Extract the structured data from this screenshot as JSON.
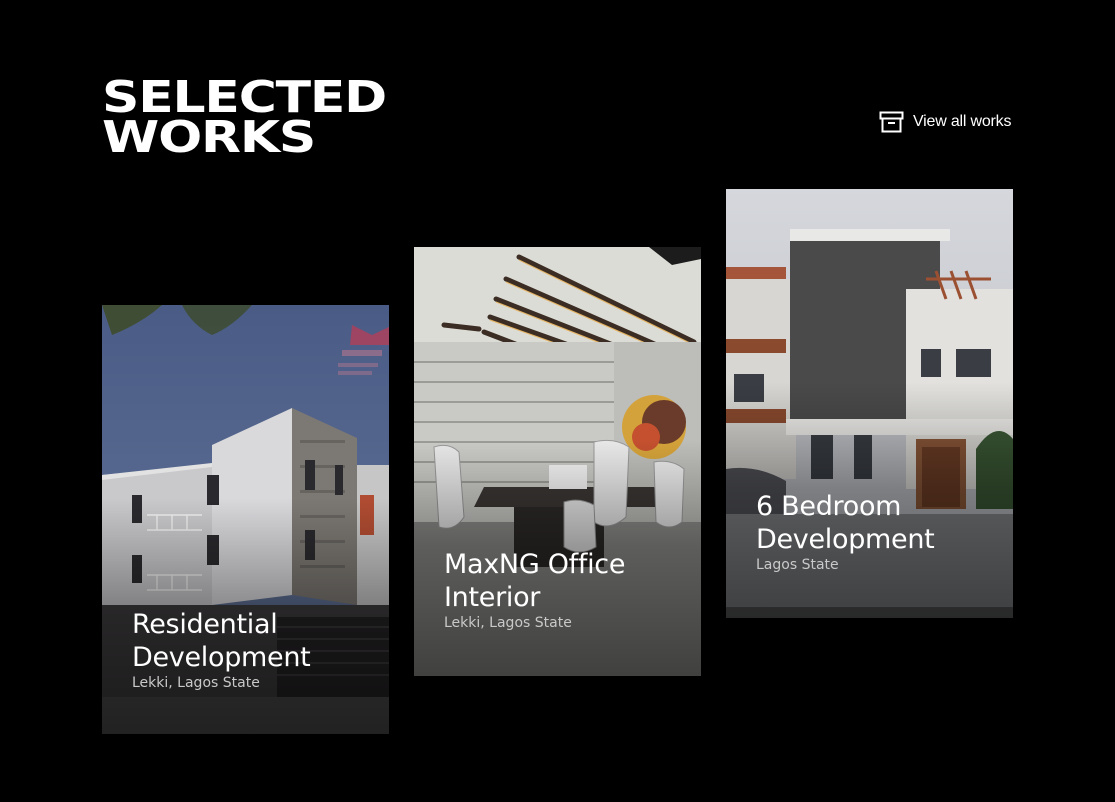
{
  "section": {
    "heading_line1": "SELECTED",
    "heading_line2": "WORKS"
  },
  "view_all": {
    "label": "View all works",
    "icon": "archive-box-icon"
  },
  "works": [
    {
      "title": "Residential Development",
      "location": "Lekki, Lagos State"
    },
    {
      "title": "MaxNG Office Interior",
      "location": "Lekki, Lagos State"
    },
    {
      "title": "6 Bedroom Development",
      "location": "Lagos State"
    }
  ],
  "colors": {
    "background": "#000000",
    "text": "#ffffff",
    "muted_text": "#c9c9c9"
  }
}
